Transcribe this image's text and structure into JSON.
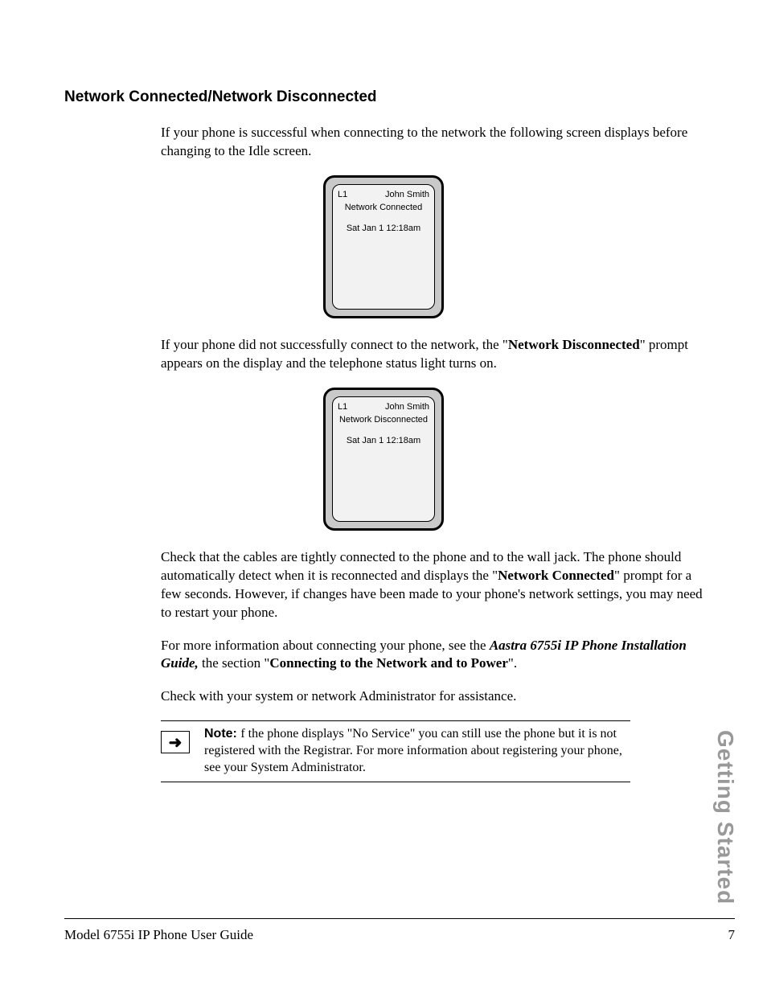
{
  "heading": "Network Connected/Network Disconnected",
  "para1": "If your phone is successful when connecting to the network the following screen displays before changing to the Idle screen.",
  "screen1": {
    "line": "L1",
    "name": "John Smith",
    "status": "Network Connected",
    "datetime": "Sat  Jan 1  12:18am"
  },
  "para2a": "If your phone did not successfully connect to the network, the \"",
  "para2b": "Network Disconnected",
  "para2c": "\" prompt appears on the display and the telephone status light turns on.",
  "screen2": {
    "line": "L1",
    "name": "John Smith",
    "status": "Network Disconnected",
    "datetime": "Sat  Jan 1  12:18am"
  },
  "para3a": "Check that the cables are tightly connected to the phone and to the wall jack. The phone should automatically detect when it is reconnected and displays the \"",
  "para3b": "Network Connected",
  "para3c": "\" prompt for a few seconds. However, if changes have been made to your phone's network settings, you may need to restart your phone.",
  "para4a": "For more information about connecting your phone, see the ",
  "para4b": "Aastra 6755i IP Phone Installation Guide,",
  "para4c": " the section \"",
  "para4d": "Connecting to the Network and to Power",
  "para4e": "\".",
  "para5": "Check with your system or network Administrator for assistance.",
  "note": {
    "label": "Note: ",
    "text": "f the phone displays \"No Service\" you can still use the phone but it is not registered with the Registrar. For more information about registering your phone, see your System Administrator."
  },
  "arrow": "➜",
  "footer": {
    "left": "Model 6755i IP Phone User Guide",
    "right": "7"
  },
  "sidetab": "Getting Started"
}
